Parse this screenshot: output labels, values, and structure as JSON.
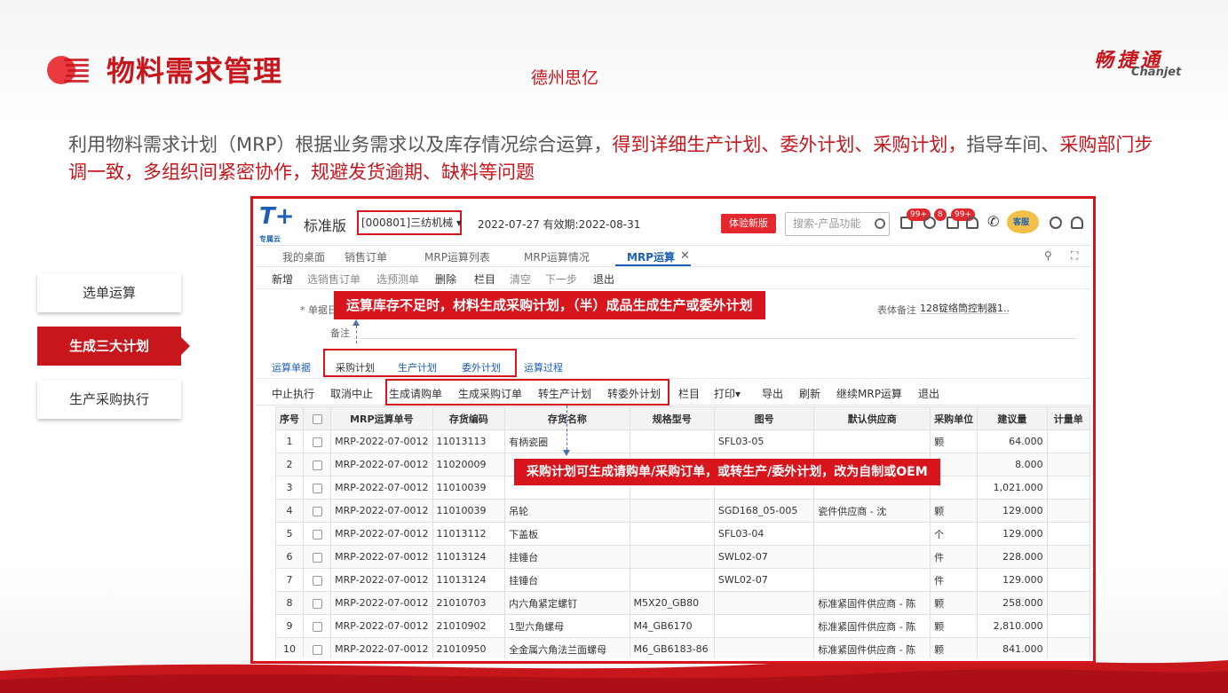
{
  "slide": {
    "title": "物料需求管理",
    "company": "德州思亿",
    "brand_cn": "畅捷通",
    "brand_en": "Chanjet",
    "desc_plain": "利用物料需求计划（MRP）根据业务需求以及库存情况综合运算，",
    "desc_highlight1": "得到详细生产计划、委外计划、采购计划，",
    "desc_plain2": "指导车间、",
    "desc_highlight2": "采购部门步调一致，多组织间紧密协作，规避发货逾期、缺料等问题",
    "accent_color": "#c8161d"
  },
  "steps": [
    {
      "label": "选单运算",
      "active": false
    },
    {
      "label": "生成三大计划",
      "active": true
    },
    {
      "label": "生产采购执行",
      "active": false
    }
  ],
  "app": {
    "logo": "T+",
    "logo_sub": "专属云",
    "version": "标准版",
    "org": "[000801]三纺机械",
    "org_icon": "chevron-down-icon",
    "date_info": "2022-07-27  有效期:2022-08-31",
    "try_button": "体验新版",
    "search_placeholder": "搜索-产品功能",
    "badges": [
      "99+",
      "8",
      "99+"
    ],
    "mascot_label": "客服",
    "tabs": [
      "我的桌面",
      "销售订单",
      "MRP运算列表",
      "MRP运算情况",
      "MRP运算"
    ],
    "toolbar1": [
      "新增",
      "选销售订单",
      "选预测单",
      "删除",
      "栏目",
      "清空",
      "下一步",
      "退出"
    ],
    "form": {
      "doc_no_label": "* 单据日",
      "remark_label": "备注",
      "body_remark_label": "表体备注",
      "body_remark_value": "128锭络筒控制器1..."
    },
    "sub_tabs": [
      "运算单据",
      "采购计划",
      "生产计划",
      "委外计划",
      "运算过程"
    ],
    "toolbar2": [
      "中止执行",
      "取消中止",
      "生成请购单",
      "生成采购订单",
      "转生产计划",
      "转委外计划",
      "栏目",
      "打印",
      "导出",
      "刷新",
      "继续MRP运算",
      "退出"
    ],
    "print_suffix": "▾",
    "columns": [
      "序号",
      "",
      "MRP运算单号",
      "存货编码",
      "存货名称",
      "规格型号",
      "图号",
      "默认供应商",
      "采购单位",
      "建议量",
      "计量单"
    ],
    "rows": [
      [
        "1",
        "MRP-2022-07-0012",
        "11013113",
        "有柄瓷圈",
        "",
        "SFL03-05",
        "",
        "颗",
        "64.000"
      ],
      [
        "2",
        "MRP-2022-07-0012",
        "11020009",
        "",
        "",
        "",
        "",
        "",
        "8.000"
      ],
      [
        "3",
        "MRP-2022-07-0012",
        "11010039",
        "",
        "",
        "",
        "",
        "",
        "1,021.000"
      ],
      [
        "4",
        "MRP-2022-07-0012",
        "11010039",
        "吊轮",
        "",
        "SGD168_05-005",
        "瓷件供应商 - 沈",
        "颗",
        "129.000"
      ],
      [
        "5",
        "MRP-2022-07-0012",
        "11013112",
        "下盖板",
        "",
        "SFL03-04",
        "",
        "个",
        "129.000"
      ],
      [
        "6",
        "MRP-2022-07-0012",
        "11013124",
        "挂锤台",
        "",
        "SWL02-07",
        "",
        "件",
        "228.000"
      ],
      [
        "7",
        "MRP-2022-07-0012",
        "11013124",
        "挂锤台",
        "",
        "SWL02-07",
        "",
        "件",
        "129.000"
      ],
      [
        "8",
        "MRP-2022-07-0012",
        "21010703",
        "内六角紧定螺钉",
        "M5X20_GB80",
        "",
        "标准紧固件供应商 - 陈",
        "颗",
        "258.000"
      ],
      [
        "9",
        "MRP-2022-07-0012",
        "21010902",
        "1型六角螺母",
        "M4_GB6170",
        "",
        "标准紧固件供应商 - 陈",
        "颗",
        "2,810.000"
      ],
      [
        "10",
        "MRP-2022-07-0012",
        "21010950",
        "全金属六角法兰面螺母",
        "M6_GB6183-86",
        "",
        "标准紧固件供应商 - 陈",
        "颗",
        "841.000"
      ]
    ]
  },
  "callouts": {
    "top": "运算库存不足时，材料生成采购计划，（半）成品生成生产或委外计划",
    "middle": "采购计划可生成请购单/采购订单，或转生产/委外计划，改为自制或OEM"
  }
}
